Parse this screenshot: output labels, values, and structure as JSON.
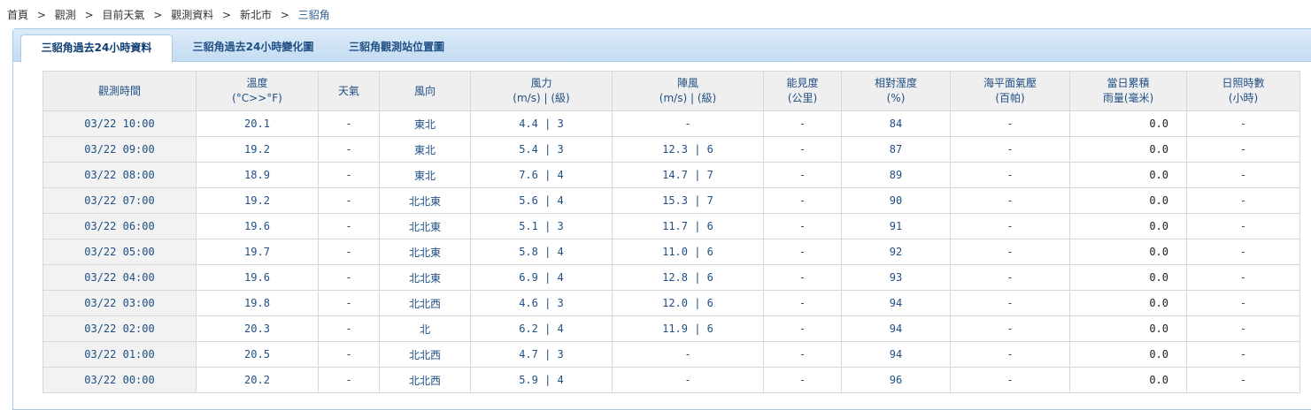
{
  "breadcrumb": {
    "items": [
      "首頁",
      "觀測",
      "目前天氣",
      "觀測資料",
      "新北市"
    ],
    "current": "三貂角",
    "separator": ">"
  },
  "tabs": [
    {
      "label": "三貂角過去24小時資料",
      "active": true
    },
    {
      "label": "三貂角過去24小時變化圖",
      "active": false
    },
    {
      "label": "三貂角觀測站位置圖",
      "active": false
    }
  ],
  "table": {
    "headers": [
      {
        "line1": "觀測時間",
        "line2": ""
      },
      {
        "line1": "溫度",
        "line2": "(°C>>°F)"
      },
      {
        "line1": "天氣",
        "line2": ""
      },
      {
        "line1": "風向",
        "line2": ""
      },
      {
        "line1": "風力",
        "line2": "(m/s) | (級)"
      },
      {
        "line1": "陣風",
        "line2": "(m/s) | (級)"
      },
      {
        "line1": "能見度",
        "line2": "(公里)"
      },
      {
        "line1": "相對溼度",
        "line2": "(%)"
      },
      {
        "line1": "海平面氣壓",
        "line2": "(百帕)"
      },
      {
        "line1": "當日累積",
        "line2": "雨量(毫米)"
      },
      {
        "line1": "日照時數",
        "line2": "(小時)"
      }
    ],
    "rows": [
      [
        "03/22 10:00",
        "20.1",
        "-",
        "東北",
        "4.4 | 3",
        "-",
        "-",
        "84",
        "-",
        "0.0",
        "-"
      ],
      [
        "03/22 09:00",
        "19.2",
        "-",
        "東北",
        "5.4 | 3",
        "12.3 | 6",
        "-",
        "87",
        "-",
        "0.0",
        "-"
      ],
      [
        "03/22 08:00",
        "18.9",
        "-",
        "東北",
        "7.6 | 4",
        "14.7 | 7",
        "-",
        "89",
        "-",
        "0.0",
        "-"
      ],
      [
        "03/22 07:00",
        "19.2",
        "-",
        "北北東",
        "5.6 | 4",
        "15.3 | 7",
        "-",
        "90",
        "-",
        "0.0",
        "-"
      ],
      [
        "03/22 06:00",
        "19.6",
        "-",
        "北北東",
        "5.1 | 3",
        "11.7 | 6",
        "-",
        "91",
        "-",
        "0.0",
        "-"
      ],
      [
        "03/22 05:00",
        "19.7",
        "-",
        "北北東",
        "5.8 | 4",
        "11.0 | 6",
        "-",
        "92",
        "-",
        "0.0",
        "-"
      ],
      [
        "03/22 04:00",
        "19.6",
        "-",
        "北北東",
        "6.9 | 4",
        "12.8 | 6",
        "-",
        "93",
        "-",
        "0.0",
        "-"
      ],
      [
        "03/22 03:00",
        "19.8",
        "-",
        "北北西",
        "4.6 | 3",
        "12.0 | 6",
        "-",
        "94",
        "-",
        "0.0",
        "-"
      ],
      [
        "03/22 02:00",
        "20.3",
        "-",
        "北",
        "6.2 | 4",
        "11.9 | 6",
        "-",
        "94",
        "-",
        "0.0",
        "-"
      ],
      [
        "03/22 01:00",
        "20.5",
        "-",
        "北北西",
        "4.7 | 3",
        "-",
        "-",
        "94",
        "-",
        "0.0",
        "-"
      ],
      [
        "03/22 00:00",
        "20.2",
        "-",
        "北北西",
        "5.9 | 4",
        "-",
        "-",
        "96",
        "-",
        "0.0",
        "-"
      ]
    ]
  }
}
